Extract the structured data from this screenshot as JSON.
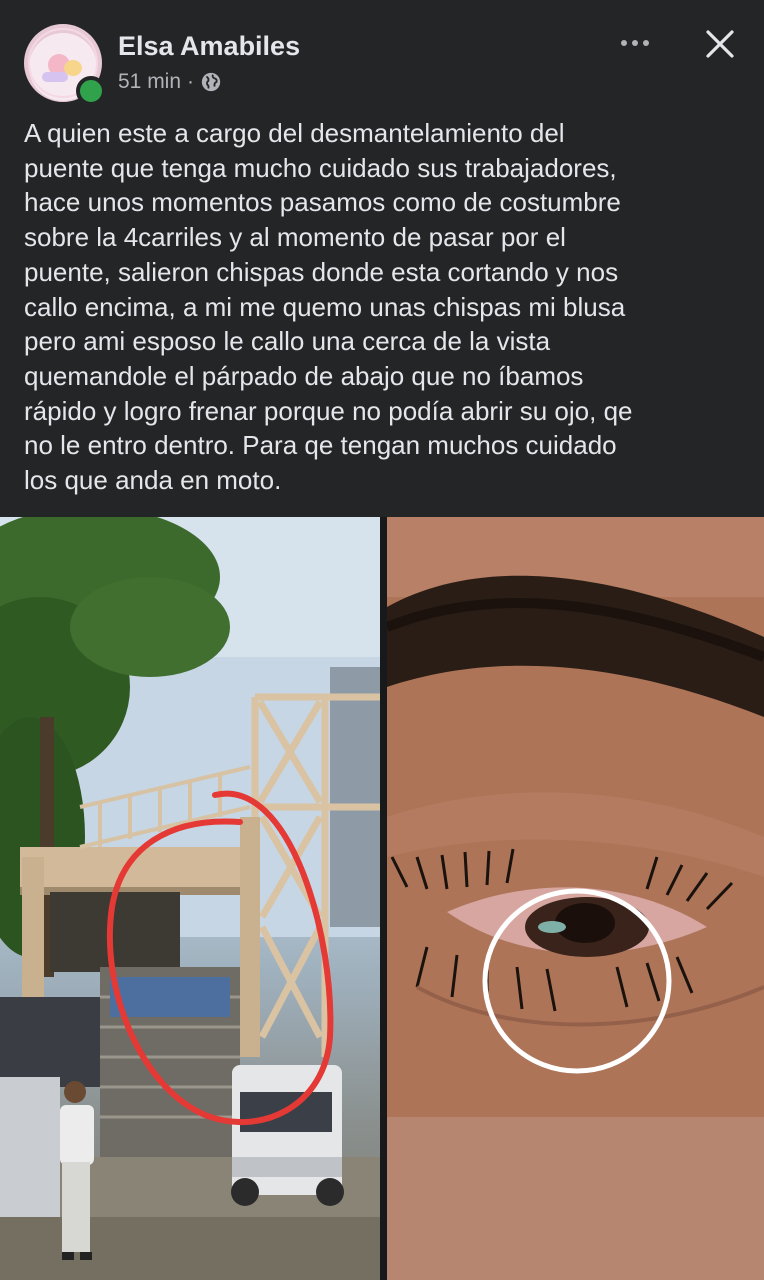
{
  "post": {
    "author": "Elsa Amabiles",
    "time": "51 min",
    "separator": "·",
    "privacy_icon": "globe-icon",
    "more_icon": "more-options-icon",
    "close_icon": "close-icon",
    "text": "A quien este a cargo del desmantelamiento del\npuente que tenga mucho cuidado sus trabajadores,\nhace unos momentos pasamos como de costumbre\nsobre la 4carriles y al momento de pasar por el\npuente, salieron chispas donde esta cortando y nos\ncallo encima, a mi me quemo unas chispas mi blusa\npero ami esposo le callo una cerca de la vista\nquemandole el párpado de abajo que no íbamos\nrápido y logro frenar porque no podía abrir su ojo, qe\nno le entro dentro. Para qe tengan muchos cuidado\nlos que anda en moto."
  },
  "photos": [
    {
      "name": "bridge-photo",
      "annotation": "red circle"
    },
    {
      "name": "eye-photo",
      "annotation": "white circle"
    }
  ],
  "colors": {
    "background": "#242526",
    "text_primary": "#e4e6eb",
    "text_secondary": "#b0b3b8",
    "online": "#31a24c",
    "annotation_red": "#e53935",
    "annotation_white": "#ffffff"
  }
}
